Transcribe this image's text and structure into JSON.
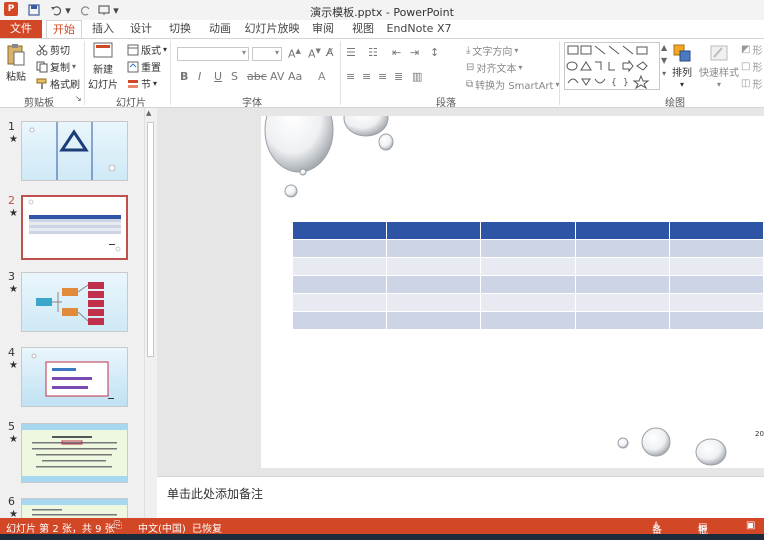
{
  "titlebar": {
    "title": "演示模板.pptx - PowerPoint",
    "app_icon": "P"
  },
  "tabs": [
    "文件",
    "开始",
    "插入",
    "设计",
    "切换",
    "动画",
    "幻灯片放映",
    "审阅",
    "视图",
    "EndNote X7"
  ],
  "ribbon": {
    "clipboard": {
      "paste": "粘贴",
      "cut": "剪切",
      "copy": "复制",
      "format_painter": "格式刷",
      "label": "剪贴板"
    },
    "slides": {
      "new_slide_1": "新建",
      "new_slide_2": "幻灯片",
      "layout": "版式",
      "reset": "重置",
      "section": "节",
      "label": "幻灯片"
    },
    "font": {
      "label": "字体"
    },
    "paragraph": {
      "text_direction": "文字方向",
      "align_text": "对齐文本",
      "smartart": "转换为 SmartArt",
      "label": "段落"
    },
    "drawing": {
      "arrange": "排列",
      "quick_styles": "快速样式",
      "shape_fill": "形",
      "shape_outline": "形",
      "shape_effects": "形",
      "label": "绘图"
    }
  },
  "thumbnails": [
    {
      "num": "1",
      "star": "★"
    },
    {
      "num": "2",
      "star": "★"
    },
    {
      "num": "3",
      "star": "★"
    },
    {
      "num": "4",
      "star": "★"
    },
    {
      "num": "5",
      "star": "★"
    },
    {
      "num": "6",
      "star": "★"
    }
  ],
  "slide": {
    "corner_text": "20"
  },
  "notes": {
    "placeholder": "单击此处添加备注"
  },
  "status": {
    "slide_info": "幻灯片 第 2 张，共 9 张",
    "language": "中文(中国)",
    "recovered": "已恢复",
    "notes_btn": "备注",
    "comments_btn": "批注"
  },
  "colors": {
    "accent": "#d24726",
    "table_header": "#2e55a5",
    "table_row_a": "#cdd4e6",
    "table_row_b": "#e8eaf1"
  }
}
